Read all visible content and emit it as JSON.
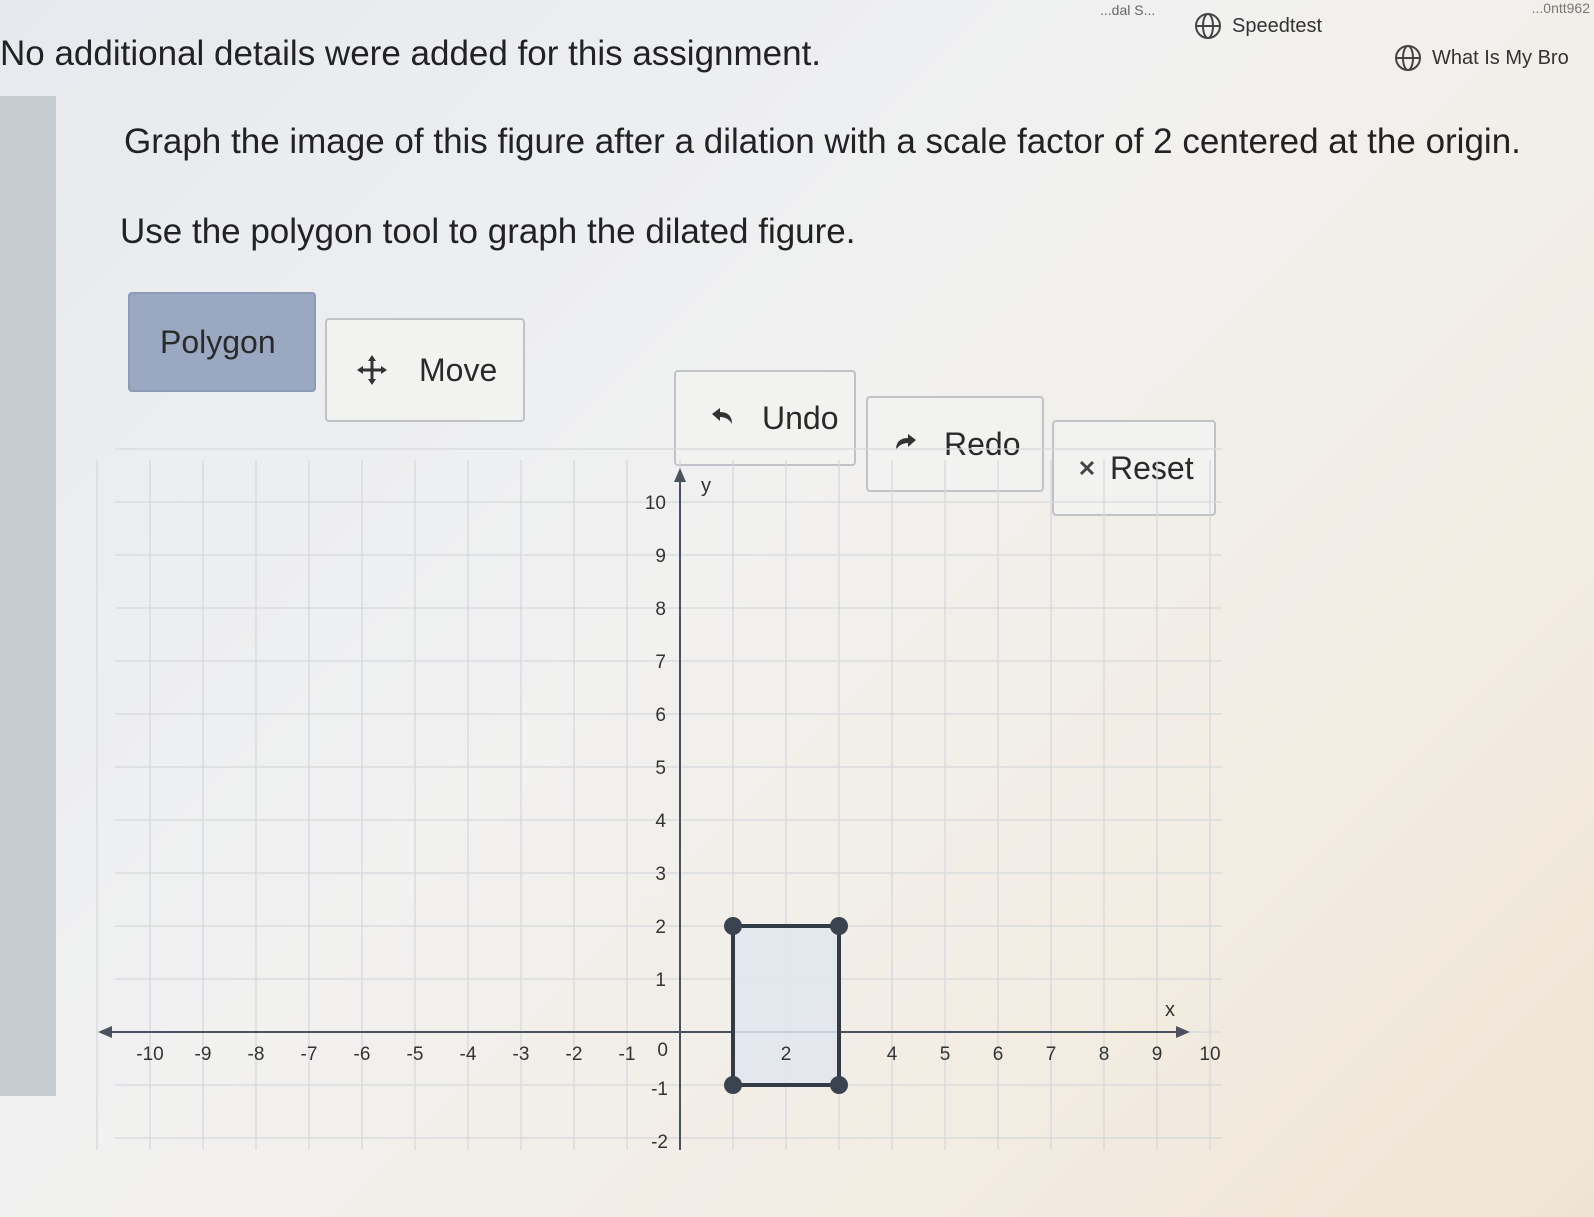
{
  "bookmarks_bar": {
    "fragment_left": "...dal S...",
    "fragment_right": "...0ntt962",
    "items": [
      {
        "label": "Speedtest",
        "icon": "globe-icon"
      },
      {
        "label": "What Is My Bro",
        "icon": "globe-icon"
      }
    ]
  },
  "assignment": {
    "details_note": "No additional details were added for this assignment.",
    "question": "Graph the image of this figure after a dilation with a scale factor of 2 centered at the origin.",
    "instruction": "Use the polygon tool to graph the dilated figure."
  },
  "toolbar": {
    "polygon_label": "Polygon",
    "move_label": "Move",
    "undo_label": "Undo",
    "redo_label": "Redo",
    "reset_label": "Reset"
  },
  "graph": {
    "x_axis_label": "x",
    "y_axis_label": "y",
    "x_ticks": [
      "-10",
      "-9",
      "-8",
      "-7",
      "-6",
      "-5",
      "-4",
      "-3",
      "-2",
      "-1",
      "2",
      "4",
      "5",
      "6",
      "7",
      "8",
      "9",
      "10"
    ],
    "y_ticks": [
      "10",
      "9",
      "8",
      "7",
      "6",
      "5",
      "4",
      "3",
      "2",
      "1"
    ],
    "origin_label": "0",
    "below_axis_labels": [
      "-1",
      "-2"
    ],
    "polygon_vertices": [
      [
        1,
        2
      ],
      [
        3,
        2
      ],
      [
        3,
        -1
      ],
      [
        1,
        -1
      ]
    ],
    "colors": {
      "polygon_fill": "#e1e6ee",
      "polygon_stroke": "#333b47",
      "vertex": "#3a4350",
      "grid": "#d5d8dc",
      "axis": "#4a5260"
    }
  }
}
